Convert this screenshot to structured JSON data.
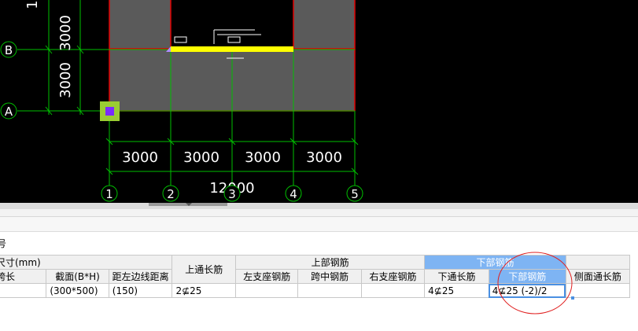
{
  "cad": {
    "background": "#000000",
    "grid_color": "#00c000",
    "beam_color": "#ffff00",
    "column_color": "#ff0000",
    "slab_color": "#5a5a5a",
    "vertical_dims": [
      "3000",
      "3000"
    ],
    "partial_dim": "1",
    "horizontal_dims": [
      "3000",
      "3000",
      "3000",
      "3000"
    ],
    "total_dim": "12000",
    "row_axes": [
      "B",
      "A"
    ],
    "column_axes": [
      "1",
      "2",
      "3",
      "4",
      "5"
    ]
  },
  "panel": {
    "title_fragment": "号",
    "header_size_label": "尺寸(mm)",
    "columns": {
      "span_length": "跨长",
      "section": "截面(B*H)",
      "offset": "距左边线距离",
      "top_through": "上通长筋",
      "top_group": "上部钢筋",
      "left_support": "左支座钢筋",
      "mid_span": "跨中钢筋",
      "right_support": "右支座钢筋",
      "bottom_group": "下部钢筋",
      "bottom_through": "下通长筋",
      "bottom_bar": "下部钢筋",
      "side_through": "侧面通长筋"
    },
    "row": {
      "span_length": "",
      "section": "(300*500)",
      "offset": "(150)",
      "top_through": "2⊈25",
      "left_support": "",
      "mid_span": "",
      "right_support": "",
      "bottom_through": "4⊈25",
      "bottom_bar": "4⊈25 (-2)/2",
      "side_through": ""
    }
  }
}
